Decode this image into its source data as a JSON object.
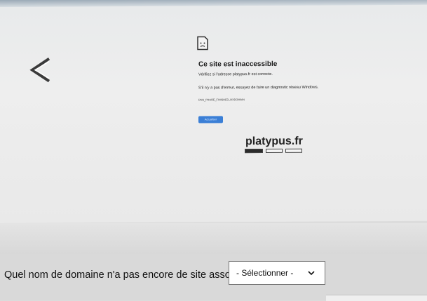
{
  "error_page": {
    "title": "Ce site est inaccessible",
    "line1": "Vérifiez si l'adresse platypus.fr est correcte.",
    "line2": "S'il n'y a pas d'erreur, essayez de faire un diagnostic réseau Windows.",
    "code": "DNS_PROBE_FINISHED_NXDOMAIN",
    "reload_label": "Actualiser"
  },
  "site": {
    "name": "platypus.fr",
    "answer_blanks": 3
  },
  "quiz": {
    "question": "Quel nom de domaine n'a pas encore de site associé ?",
    "select_value": "- Sélectionner -"
  }
}
